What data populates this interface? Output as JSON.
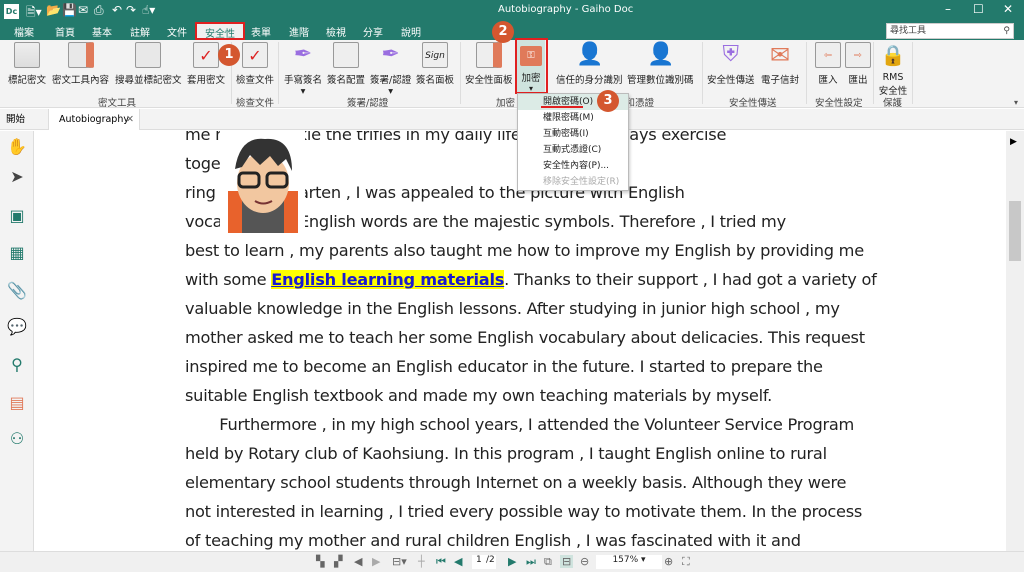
{
  "app": {
    "title": "Autobiography - Gaiho Doc",
    "icon": "Dc"
  },
  "menus": [
    "檔案",
    "首頁",
    "基本",
    "註解",
    "文件",
    "安全性",
    "表單",
    "進階",
    "檢視",
    "分享",
    "說明"
  ],
  "search_placeholder": "尋找工具",
  "ribbon": {
    "buttons": [
      "標記密文",
      "密文工具內容",
      "搜尋並標記密文",
      "套用密文",
      "檢查文件",
      "手寫簽名",
      "簽名配置",
      "簽署/認證",
      "簽名面板",
      "安全性面板",
      "加密",
      "信任的身分識別",
      "管理數位識別碼",
      "安全性傳送",
      "電子信封",
      "匯入",
      "匯出",
      "RMS 安全性"
    ],
    "groups": [
      "密文工具",
      "檢查文件",
      "簽署/認證",
      "加密",
      "數位識別碼和憑證",
      "安全性傳送",
      "安全性設定",
      "保護"
    ]
  },
  "badges": [
    "1",
    "2",
    "3"
  ],
  "encrypt_menu": [
    "開啟密碼(O)",
    "權限密碼(M)",
    "互動密碼(I)",
    "互動式憑證(C)",
    "安全性內容(P)...",
    "移除安全性設定(R)"
  ],
  "tabs": [
    "開始",
    "Autobiography"
  ],
  "document": {
    "lines": [
      "me how to tackle the trifles in my daily life.                          , and we always exercise",
      "toge                    kends.",
      "                        ring in kindergarten , I was appealed to the picture with English",
      "voca                   ught the English words are the majestic symbols. Therefore , I tried my",
      "best to learn , my parents also taught me how to improve my English by providing me",
      "with some ",
      "valuable knowledge in the English lessons. After studying in junior high school , my",
      "mother asked me to teach her some English vocabulary about delicacies. This request",
      "inspired me to become an English educator in the future. I started to prepare the",
      "suitable English textbook and made my own teaching materials by myself.",
      "       Furthermore , in my high school years, I attended the Volunteer Service Program",
      "held by Rotary club of Kaohsiung. In this program , I taught English online to rural",
      "elementary school students through Internet on a weekly basis. Although they were",
      "not interested in learning , I tried every possible way to motivate them. In the process",
      "of teaching my mother and rural children English , I was fascinated with it and"
    ],
    "highlight": "English learning materials",
    "after_highlight": ". Thanks to their support , I had got a variety of"
  },
  "status": {
    "page": "1",
    "pages": "/2",
    "zoom": "157%"
  },
  "colors": {
    "accent": "#237a6c",
    "badge": "#d4572f",
    "highlight": "#ffff00"
  }
}
